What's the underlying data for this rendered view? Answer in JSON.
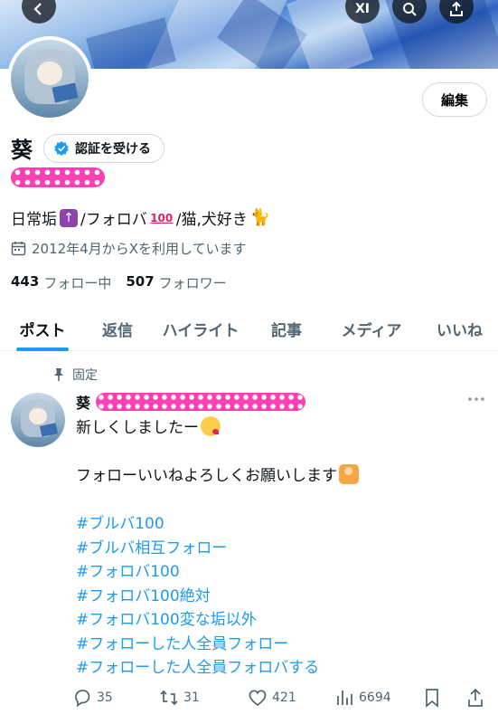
{
  "banner": {
    "back_icon": "back-arrow-icon",
    "grok_label": "XI",
    "search_icon": "search-icon",
    "share_icon": "share-icon"
  },
  "profile": {
    "display_name": "葵",
    "edit_label": "編集",
    "verify_label": "認証を受ける",
    "bio": {
      "part1": "日常垢",
      "part2": "/フォロバ",
      "emoji_100": "100",
      "part3": "/猫,犬好き"
    },
    "joined": "2012年4月からXを利用しています",
    "following_count": "443",
    "following_label": "フォロー中",
    "followers_count": "507",
    "followers_label": "フォロワー"
  },
  "tabs": [
    {
      "label": "ポスト",
      "active": true
    },
    {
      "label": "返信",
      "active": false
    },
    {
      "label": "ハイライト",
      "active": false
    },
    {
      "label": "記事",
      "active": false
    },
    {
      "label": "メディア",
      "active": false
    },
    {
      "label": "いいね",
      "active": false
    }
  ],
  "post": {
    "pinned_label": "固定",
    "author_name": "葵",
    "line1": "新しくしましたー",
    "line2": "フォローいいねよろしくお願いします",
    "hashtags": [
      "#ブルバ100",
      "#ブルバ相互フォロー",
      "#フォロバ100",
      "#フォロバ100絶対",
      "#フォロバ100変な垢以外",
      "#フォローした人全員フォロー",
      "#フォローした人全員フォロバする"
    ],
    "replies": "35",
    "reposts": "31",
    "likes": "421",
    "views": "6694"
  },
  "colors": {
    "accent": "#1d9bf0",
    "text": "#0f1419",
    "muted": "#536471",
    "redaction": "#ff3fb4"
  }
}
